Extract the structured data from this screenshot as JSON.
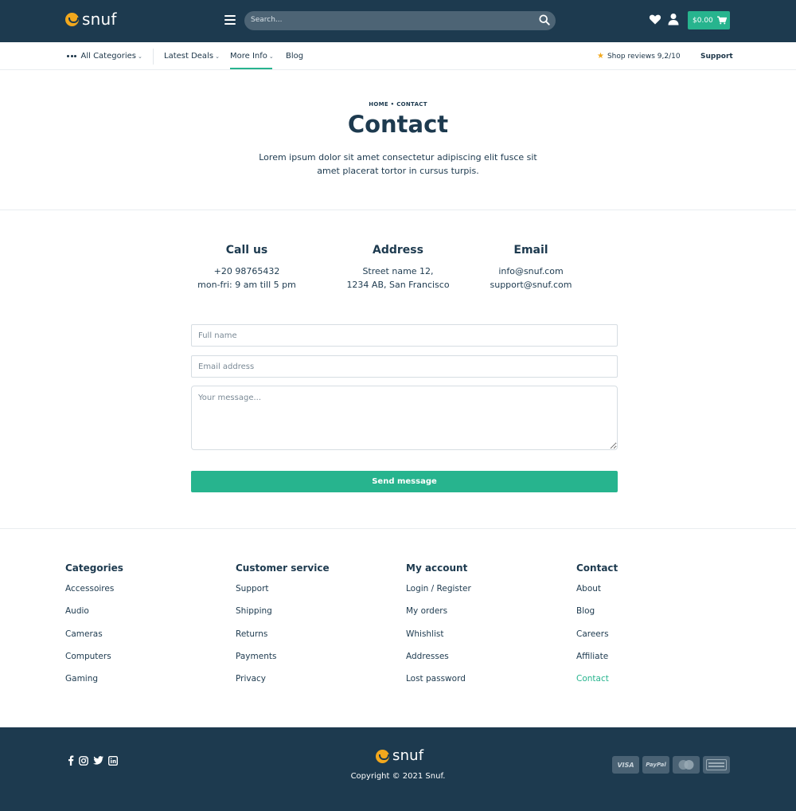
{
  "header": {
    "logo_text": "snuf",
    "search_placeholder": "Search...",
    "cart_total": "$0.00"
  },
  "nav": {
    "all_categories": "All Categories",
    "latest_deals": "Latest Deals",
    "more_info": "More Info",
    "blog": "Blog",
    "reviews": "Shop reviews 9,2/10",
    "support": "Support"
  },
  "hero": {
    "breadcrumb": "HOME • CONTACT",
    "title": "Contact",
    "intro": "Lorem ipsum dolor sit amet consectetur adipiscing elit fusce sit amet placerat tortor in cursus turpis."
  },
  "info": [
    {
      "title": "Call us",
      "line1": "+20 98765432",
      "line2": "mon-fri: 9 am till 5 pm"
    },
    {
      "title": "Address",
      "line1": "Street name 12,",
      "line2": "1234 AB, San Francisco"
    },
    {
      "title": "Email",
      "line1": "info@snuf.com",
      "line2": "support@snuf.com"
    }
  ],
  "form": {
    "name_placeholder": "Full name",
    "email_placeholder": "Email address",
    "message_placeholder": "Your message...",
    "send_label": "Send message"
  },
  "footer": {
    "columns": [
      {
        "title": "Categories",
        "links": [
          "Accessoires",
          "Audio",
          "Cameras",
          "Computers",
          "Gaming"
        ]
      },
      {
        "title": "Customer service",
        "links": [
          "Support",
          "Shipping",
          "Returns",
          "Payments",
          "Privacy"
        ]
      },
      {
        "title": "My account",
        "links": [
          "Login / Register",
          "My orders",
          "Whishlist",
          "Addresses",
          "Lost password"
        ]
      },
      {
        "title": "Contact",
        "links": [
          "About",
          "Blog",
          "Careers",
          "Affiliate",
          "Contact"
        ]
      }
    ],
    "logo_text": "snuf",
    "copyright": "Copyright © 2021 Snuf.",
    "payments": [
      "VISA",
      "PayPal",
      "mastercard",
      "amex"
    ]
  },
  "colors": {
    "navy": "#1d3a4f",
    "accent": "#27b48e",
    "logo_yellow": "#f2a81d"
  }
}
